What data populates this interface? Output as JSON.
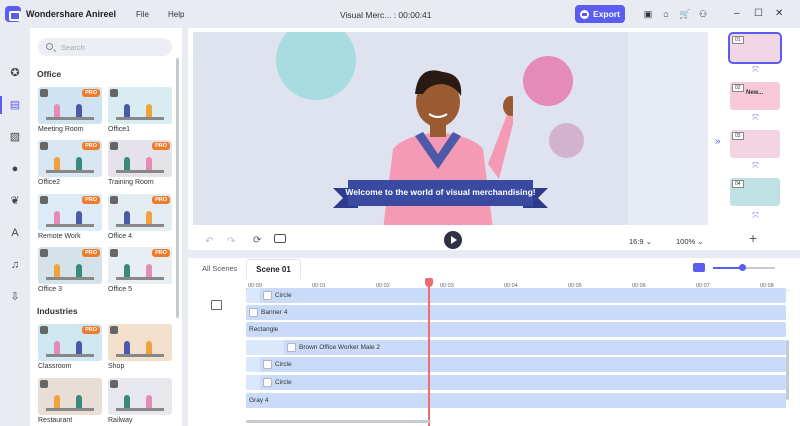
{
  "app": {
    "title": "Wondershare Anireel",
    "document": "Visual Merc... : 00:00:41"
  },
  "menu": {
    "file": "File",
    "help": "Help"
  },
  "toolbar": {
    "export_label": "Export"
  },
  "window_controls": {
    "minimize": "–",
    "maximize": "☐",
    "close": "✕"
  },
  "library": {
    "search_placeholder": "Search",
    "sections": [
      {
        "title": "Office",
        "items": [
          {
            "label": "Meeting Room",
            "pro": "PRO"
          },
          {
            "label": "Office1",
            "pro": ""
          },
          {
            "label": "Office2",
            "pro": "PRO"
          },
          {
            "label": "Training Room",
            "pro": "PRO"
          },
          {
            "label": "Remote Work",
            "pro": "PRO"
          },
          {
            "label": "Office 4",
            "pro": "PRO"
          },
          {
            "label": "Office 3",
            "pro": "PRO"
          },
          {
            "label": "Office 5",
            "pro": "PRO"
          }
        ]
      },
      {
        "title": "Industries",
        "items": [
          {
            "label": "Classroom",
            "pro": "PRO"
          },
          {
            "label": "Shop",
            "pro": ""
          },
          {
            "label": "Restaurant",
            "pro": ""
          },
          {
            "label": "Railway",
            "pro": ""
          }
        ]
      }
    ]
  },
  "preview": {
    "banner_text": "Welcome to the world of visual merchandising!",
    "aspect_ratio": "16:9",
    "zoom": "100%"
  },
  "scenes": {
    "thumbs": [
      {
        "num": "01"
      },
      {
        "num": "02",
        "text": "New..."
      },
      {
        "num": "03"
      },
      {
        "num": "04"
      }
    ],
    "add_label": "+",
    "collapse_label": "»"
  },
  "timeline": {
    "tabs": [
      "All Scenes",
      "Scene 01"
    ],
    "ruler": [
      "00:00",
      "00:01",
      "00:02",
      "00:03",
      "00:04",
      "00:05",
      "00:06",
      "00:07",
      "00:08"
    ],
    "tracks": [
      "Circle",
      "Banner 4",
      "Rectangle",
      "Brown Office Worker Male 2",
      "Circle",
      "Circle",
      "Gray 4"
    ]
  },
  "colors": {
    "accent": "#5b5df0",
    "pro_badge": "#f07b2b",
    "playhead": "#f06c6c",
    "track": "#dbe7fb"
  }
}
